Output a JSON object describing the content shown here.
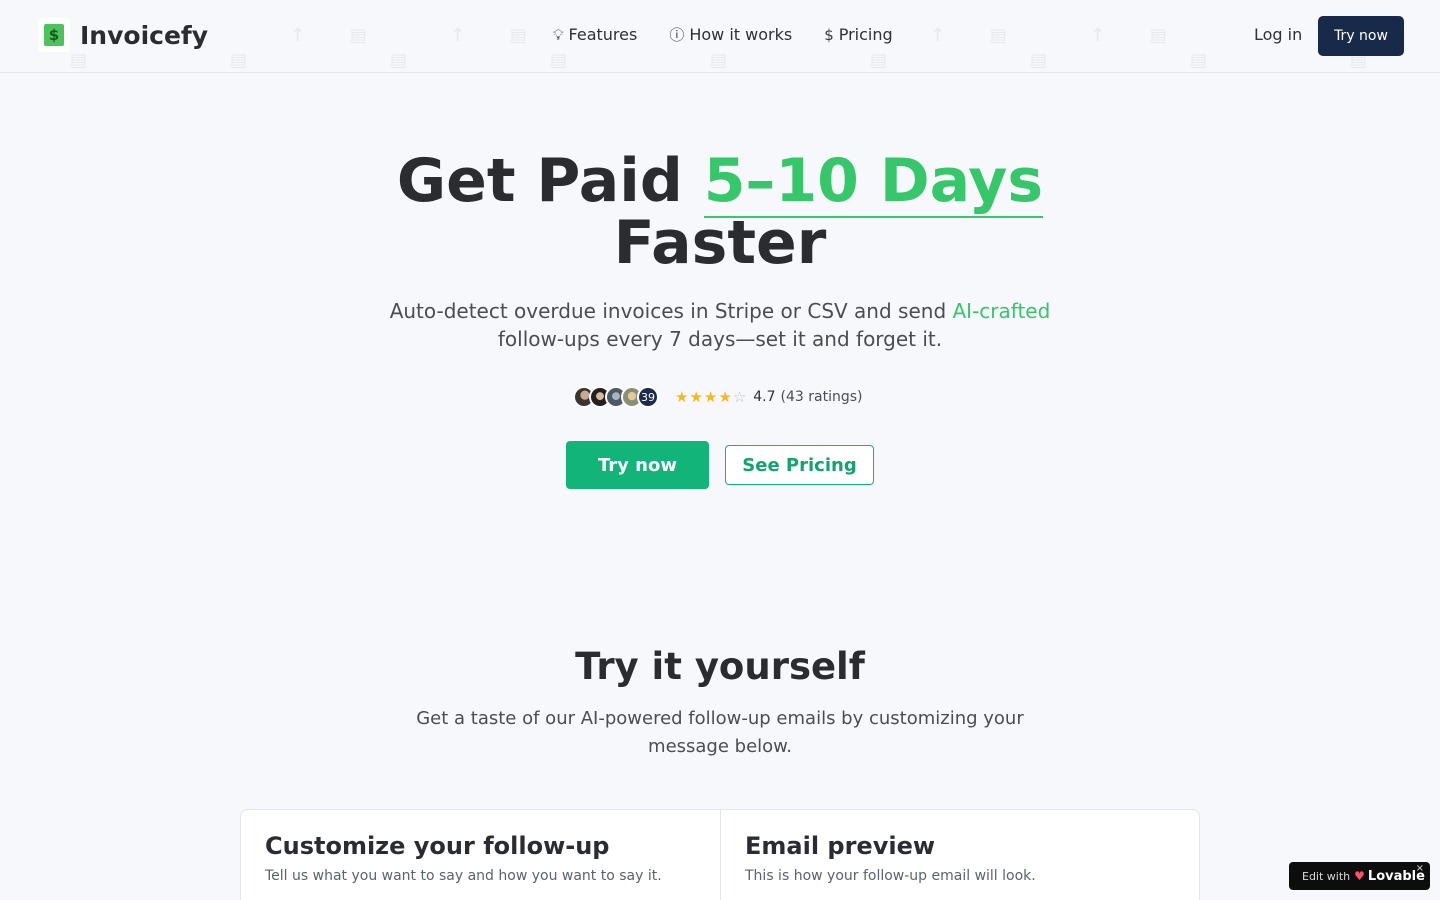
{
  "header": {
    "brand_name": "Invoicefy",
    "brand_icon": "dollar-doc-icon",
    "nav": [
      {
        "label": "Features",
        "icon": "lightbulb-icon"
      },
      {
        "label": "How it works",
        "icon": "info-icon"
      },
      {
        "label": "Pricing",
        "icon": "dollar-icon"
      }
    ],
    "login_label": "Log in",
    "try_label": "Try now"
  },
  "hero": {
    "title_prefix": "Get Paid",
    "title_accent": "5–10 Days",
    "title_suffix": "Faster",
    "subtitle_prefix": "Auto-detect overdue invoices in Stripe or CSV and send",
    "subtitle_accent": "AI-crafted",
    "subtitle_suffix": "follow-ups every 7 days—set it and forget it.",
    "avatar_count": "39",
    "rating_value": "4.7",
    "rating_count": "(43 ratings)",
    "stars_filled": 4,
    "stars_total": 5,
    "cta_primary": "Try now",
    "cta_secondary": "See Pricing"
  },
  "try_section": {
    "title": "Try it yourself",
    "subtitle": "Get a taste of our AI-powered follow-up emails by customizing your message below.",
    "cards": [
      {
        "title": "Customize your follow-up",
        "desc": "Tell us what you want to say and how you want to say it."
      },
      {
        "title": "Email preview",
        "desc": "This is how your follow-up email will look."
      }
    ]
  },
  "badge": {
    "prefix": "Edit with",
    "brand": "Lovable",
    "close": "×"
  },
  "colors": {
    "accent_green": "#36c76b",
    "cta_green": "#12b47a",
    "navy": "#182a4a"
  }
}
